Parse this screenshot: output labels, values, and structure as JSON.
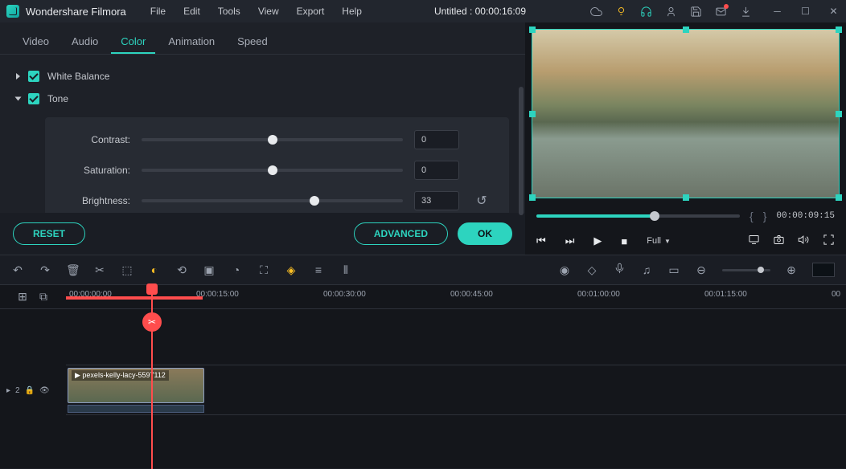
{
  "app": {
    "name": "Wondershare Filmora",
    "title": "Untitled : 00:00:16:09"
  },
  "menu": [
    "File",
    "Edit",
    "Tools",
    "View",
    "Export",
    "Help"
  ],
  "tabs": [
    "Video",
    "Audio",
    "Color",
    "Animation",
    "Speed"
  ],
  "activeTab": 2,
  "sections": {
    "whiteBalance": {
      "label": "White Balance",
      "checked": true,
      "expanded": false
    },
    "tone": {
      "label": "Tone",
      "checked": true,
      "expanded": true,
      "sliders": [
        {
          "label": "Contrast:",
          "value": "0",
          "pos": 50
        },
        {
          "label": "Saturation:",
          "value": "0",
          "pos": 50
        },
        {
          "label": "Brightness:",
          "value": "33",
          "pos": 66
        }
      ]
    }
  },
  "buttons": {
    "reset": "RESET",
    "advanced": "ADVANCED",
    "ok": "OK"
  },
  "preview": {
    "timecode": "00:00:09:15",
    "scrubPos": 58,
    "sizeLabel": "Full"
  },
  "timeline": {
    "marks": [
      "00:00:00:00",
      "00:00:15:00",
      "00:00:30:00",
      "00:00:45:00",
      "00:01:00:00",
      "00:01:15:00",
      "00"
    ],
    "clipName": "pexels-kelly-lacy-5597112",
    "trackLabel": "2"
  }
}
